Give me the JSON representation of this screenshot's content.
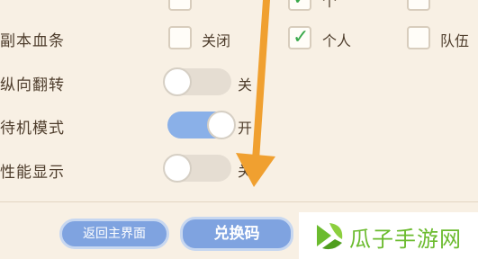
{
  "settings": {
    "partial_top_row": {
      "option_b_label": "个"
    },
    "dungeon_hp_bar": {
      "label": "副本血条",
      "options": [
        {
          "label": "关闭",
          "checked": false
        },
        {
          "label": "个人",
          "checked": true
        },
        {
          "label": "队伍",
          "checked": false
        }
      ]
    },
    "vertical_flip": {
      "label": "纵向翻转",
      "state_label": "关",
      "on": false
    },
    "standby_mode": {
      "label": "待机模式",
      "state_label": "开",
      "on": true
    },
    "performance_display": {
      "label": "性能显示",
      "state_label": "关",
      "on": false
    }
  },
  "buttons": {
    "back_to_main": "返回主界面",
    "redeem_code": "兑换码"
  },
  "watermark": {
    "text": "瓜子手游网"
  },
  "colors": {
    "accent_blue": "#7fa3e0",
    "toggle_on": "#8ab0e8",
    "check_green": "#39a84a",
    "arrow_orange": "#f0a030",
    "brand_green": "#6bbb2e"
  },
  "icons": {
    "checkmark": "check-icon",
    "arrow": "orange-arrow-annotation",
    "logo": "guazi-logo-icon"
  }
}
